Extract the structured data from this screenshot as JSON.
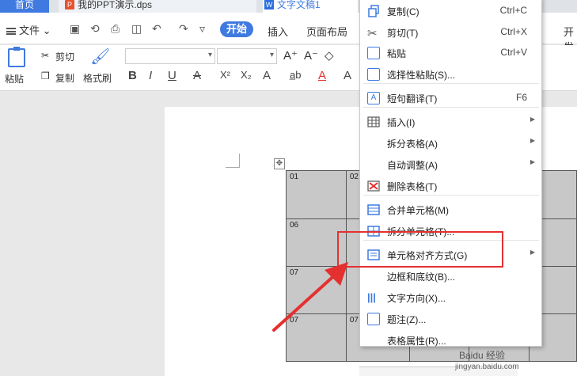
{
  "tabs": {
    "home": "首页",
    "ppt": "我的PPT演示.dps",
    "word": "文字文稿1"
  },
  "menubar": {
    "file": "文件",
    "start": "开始",
    "insert": "插入",
    "layout": "页面布局",
    "dev": "开发"
  },
  "toolbar": {
    "paste": "粘贴",
    "cut": "剪切",
    "copy": "复制",
    "format_painter": "格式刷",
    "bold": "B",
    "italic": "I",
    "underline": "U",
    "font_color": "A",
    "superscript": "X²",
    "subscript": "X₂",
    "highlight": "A",
    "text_effect": "A"
  },
  "table": {
    "rows": [
      [
        "01",
        "02",
        "",
        "",
        ""
      ],
      [
        "06",
        "",
        "",
        "",
        ""
      ],
      [
        "07",
        "",
        "",
        "",
        ""
      ],
      [
        "07",
        "07",
        "",
        "",
        ""
      ]
    ]
  },
  "context_menu": {
    "items": [
      {
        "label": "复制(C)",
        "shortcut": "Ctrl+C",
        "icon": "copy-icon"
      },
      {
        "label": "剪切(T)",
        "shortcut": "Ctrl+X",
        "icon": "scissors-icon"
      },
      {
        "label": "粘贴",
        "shortcut": "Ctrl+V",
        "icon": "paste-icon"
      },
      {
        "label": "选择性粘贴(S)...",
        "shortcut": "",
        "icon": "paste-special-icon"
      },
      {
        "label": "短句翻译(T)",
        "shortcut": "F6",
        "icon": "translate-icon"
      },
      {
        "label": "插入(I)",
        "shortcut": "",
        "icon": "table-insert-icon"
      },
      {
        "label": "拆分表格(A)",
        "shortcut": "",
        "icon": ""
      },
      {
        "label": "自动调整(A)",
        "shortcut": "",
        "icon": ""
      },
      {
        "label": "删除表格(T)",
        "shortcut": "",
        "icon": "delete-table-icon"
      },
      {
        "label": "合并单元格(M)",
        "shortcut": "",
        "icon": "merge-cells-icon"
      },
      {
        "label": "拆分单元格(T)...",
        "shortcut": "",
        "icon": "split-cells-icon"
      },
      {
        "label": "单元格对齐方式(G)",
        "shortcut": "",
        "icon": "cell-align-icon"
      },
      {
        "label": "边框和底纹(B)...",
        "shortcut": "",
        "icon": ""
      },
      {
        "label": "文字方向(X)...",
        "shortcut": "",
        "icon": "text-direction-icon"
      },
      {
        "label": "题注(Z)...",
        "shortcut": "",
        "icon": "caption-icon"
      },
      {
        "label": "表格属性(R)...",
        "shortcut": "",
        "icon": ""
      }
    ]
  },
  "watermark": "Baidu 经验",
  "watermark_url": "jingyan.baidu.com",
  "colors": {
    "accent": "#3f7ae0",
    "highlight_box": "#e53030",
    "table_fill": "#c8c8c8"
  }
}
